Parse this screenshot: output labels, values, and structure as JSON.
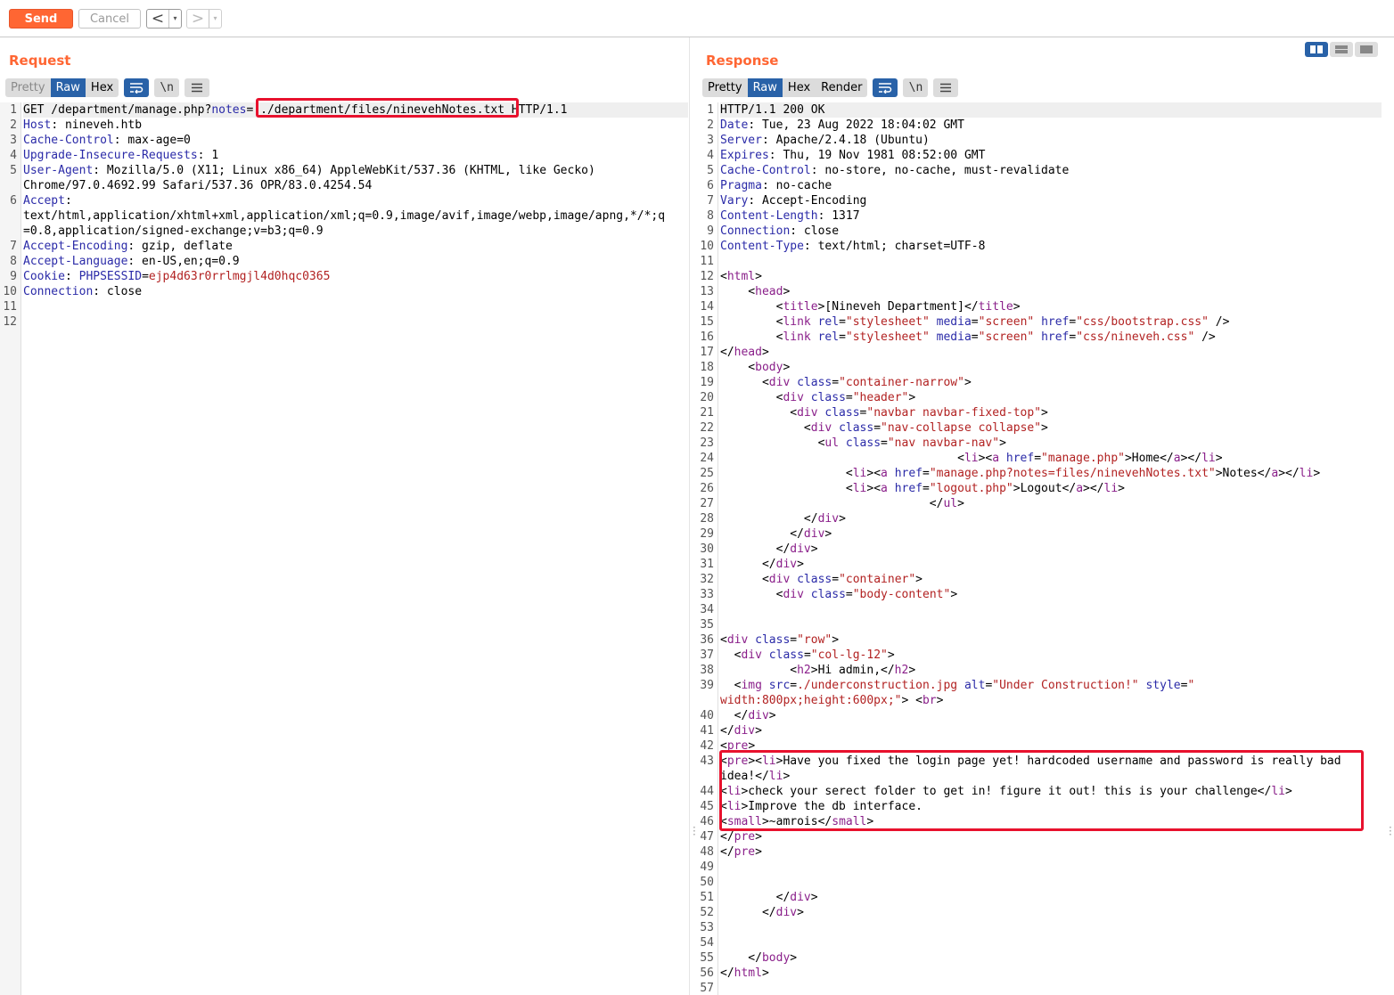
{
  "toolbar": {
    "send_label": "Send",
    "cancel_label": "Cancel",
    "back_label": "<",
    "forward_label": ">",
    "dropdown_glyph": "▾"
  },
  "request": {
    "title": "Request",
    "tabs": [
      "Pretty",
      "Raw",
      "Hex"
    ],
    "active_tab": "Raw",
    "tools": [
      "wrap-icon",
      "\\n",
      "menu-icon"
    ],
    "line_numbers": [
      "1",
      "2",
      "3",
      "4",
      "5",
      "",
      "6",
      "",
      "",
      "7",
      "8",
      "9",
      "10",
      "11",
      "12"
    ],
    "lines": [
      [
        [
          "t",
          "GET /department/manage.php?"
        ],
        [
          "k",
          "notes"
        ],
        [
          "t",
          "=../department/files/ninevehNotes.txt HTTP/1.1"
        ]
      ],
      [
        [
          "k",
          "Host"
        ],
        [
          "t",
          ": nineveh.htb"
        ]
      ],
      [
        [
          "k",
          "Cache-Control"
        ],
        [
          "t",
          ": max-age=0"
        ]
      ],
      [
        [
          "k",
          "Upgrade-Insecure-Requests"
        ],
        [
          "t",
          ": 1"
        ]
      ],
      [
        [
          "k",
          "User-Agent"
        ],
        [
          "t",
          ": Mozilla/5.0 (X11; Linux x86_64) AppleWebKit/537.36 (KHTML, like Gecko)"
        ]
      ],
      [
        [
          "t",
          "Chrome/97.0.4692.99 Safari/537.36 OPR/83.0.4254.54"
        ]
      ],
      [
        [
          "k",
          "Accept"
        ],
        [
          "t",
          ":"
        ]
      ],
      [
        [
          "t",
          "text/html,application/xhtml+xml,application/xml;q=0.9,image/avif,image/webp,image/apng,*/*;q"
        ]
      ],
      [
        [
          "t",
          "=0.8,application/signed-exchange;v=b3;q=0.9"
        ]
      ],
      [
        [
          "k",
          "Accept-Encoding"
        ],
        [
          "t",
          ": gzip, deflate"
        ]
      ],
      [
        [
          "k",
          "Accept-Language"
        ],
        [
          "t",
          ": en-US,en;q=0.9"
        ]
      ],
      [
        [
          "k",
          "Cookie"
        ],
        [
          "t",
          ": "
        ],
        [
          "k",
          "PHPSESSID"
        ],
        [
          "t",
          "="
        ],
        [
          "ck",
          "ejp4d63r0rrlmgjl4d0hqc0365"
        ]
      ],
      [
        [
          "k",
          "Connection"
        ],
        [
          "t",
          ": close"
        ]
      ],
      [
        [
          "t",
          ""
        ]
      ],
      [
        [
          "t",
          ""
        ]
      ]
    ]
  },
  "response": {
    "title": "Response",
    "tabs": [
      "Pretty",
      "Raw",
      "Hex",
      "Render"
    ],
    "active_tab": "Raw",
    "tools": [
      "wrap-icon",
      "\\n",
      "menu-icon"
    ],
    "line_numbers": [
      "1",
      "2",
      "3",
      "4",
      "5",
      "6",
      "7",
      "8",
      "9",
      "10",
      "11",
      "12",
      "13",
      "14",
      "15",
      "16",
      "17",
      "18",
      "19",
      "20",
      "21",
      "22",
      "23",
      "24",
      "25",
      "26",
      "27",
      "28",
      "29",
      "30",
      "31",
      "32",
      "33",
      "34",
      "35",
      "36",
      "37",
      "38",
      "39",
      "",
      "40",
      "41",
      "42",
      "43",
      "",
      "44",
      "45",
      "46",
      "47",
      "48",
      "49",
      "50",
      "51",
      "52",
      "53",
      "54",
      "55",
      "56",
      "57"
    ],
    "lines": [
      [
        [
          "t",
          "HTTP/1.1 200 OK"
        ]
      ],
      [
        [
          "k",
          "Date"
        ],
        [
          "t",
          ": Tue, 23 Aug 2022 18:04:02 GMT"
        ]
      ],
      [
        [
          "k",
          "Server"
        ],
        [
          "t",
          ": Apache/2.4.18 (Ubuntu)"
        ]
      ],
      [
        [
          "k",
          "Expires"
        ],
        [
          "t",
          ": Thu, 19 Nov 1981 08:52:00 GMT"
        ]
      ],
      [
        [
          "k",
          "Cache-Control"
        ],
        [
          "t",
          ": no-store, no-cache, must-revalidate"
        ]
      ],
      [
        [
          "k",
          "Pragma"
        ],
        [
          "t",
          ": no-cache"
        ]
      ],
      [
        [
          "k",
          "Vary"
        ],
        [
          "t",
          ": Accept-Encoding"
        ]
      ],
      [
        [
          "k",
          "Content-Length"
        ],
        [
          "t",
          ": 1317"
        ]
      ],
      [
        [
          "k",
          "Connection"
        ],
        [
          "t",
          ": close"
        ]
      ],
      [
        [
          "k",
          "Content-Type"
        ],
        [
          "t",
          ": text/html; charset=UTF-8"
        ]
      ],
      [
        [
          "t",
          ""
        ]
      ],
      [
        [
          "t",
          "<"
        ],
        [
          "tg",
          "html"
        ],
        [
          "t",
          ">"
        ]
      ],
      [
        [
          "t",
          "    <"
        ],
        [
          "tg",
          "head"
        ],
        [
          "t",
          ">"
        ]
      ],
      [
        [
          "t",
          "        <"
        ],
        [
          "tg",
          "title"
        ],
        [
          "t",
          ">[Nineveh Department]</"
        ],
        [
          "tg",
          "title"
        ],
        [
          "t",
          ">"
        ]
      ],
      [
        [
          "t",
          "        <"
        ],
        [
          "tg",
          "link"
        ],
        [
          "t",
          " "
        ],
        [
          "at",
          "rel"
        ],
        [
          "t",
          "="
        ],
        [
          "st",
          "\"stylesheet\""
        ],
        [
          "t",
          " "
        ],
        [
          "at",
          "media"
        ],
        [
          "t",
          "="
        ],
        [
          "st",
          "\"screen\""
        ],
        [
          "t",
          " "
        ],
        [
          "at",
          "href"
        ],
        [
          "t",
          "="
        ],
        [
          "st",
          "\"css/bootstrap.css\""
        ],
        [
          "t",
          " />"
        ]
      ],
      [
        [
          "t",
          "        <"
        ],
        [
          "tg",
          "link"
        ],
        [
          "t",
          " "
        ],
        [
          "at",
          "rel"
        ],
        [
          "t",
          "="
        ],
        [
          "st",
          "\"stylesheet\""
        ],
        [
          "t",
          " "
        ],
        [
          "at",
          "media"
        ],
        [
          "t",
          "="
        ],
        [
          "st",
          "\"screen\""
        ],
        [
          "t",
          " "
        ],
        [
          "at",
          "href"
        ],
        [
          "t",
          "="
        ],
        [
          "st",
          "\"css/nineveh.css\""
        ],
        [
          "t",
          " />"
        ]
      ],
      [
        [
          "t",
          "</"
        ],
        [
          "tg",
          "head"
        ],
        [
          "t",
          ">"
        ]
      ],
      [
        [
          "t",
          "    <"
        ],
        [
          "tg",
          "body"
        ],
        [
          "t",
          ">"
        ]
      ],
      [
        [
          "t",
          "      <"
        ],
        [
          "tg",
          "div"
        ],
        [
          "t",
          " "
        ],
        [
          "at",
          "class"
        ],
        [
          "t",
          "="
        ],
        [
          "st",
          "\"container-narrow\""
        ],
        [
          "t",
          ">"
        ]
      ],
      [
        [
          "t",
          "        <"
        ],
        [
          "tg",
          "div"
        ],
        [
          "t",
          " "
        ],
        [
          "at",
          "class"
        ],
        [
          "t",
          "="
        ],
        [
          "st",
          "\"header\""
        ],
        [
          "t",
          ">"
        ]
      ],
      [
        [
          "t",
          "          <"
        ],
        [
          "tg",
          "div"
        ],
        [
          "t",
          " "
        ],
        [
          "at",
          "class"
        ],
        [
          "t",
          "="
        ],
        [
          "st",
          "\"navbar navbar-fixed-top\""
        ],
        [
          "t",
          ">"
        ]
      ],
      [
        [
          "t",
          "            <"
        ],
        [
          "tg",
          "div"
        ],
        [
          "t",
          " "
        ],
        [
          "at",
          "class"
        ],
        [
          "t",
          "="
        ],
        [
          "st",
          "\"nav-collapse collapse\""
        ],
        [
          "t",
          ">"
        ]
      ],
      [
        [
          "t",
          "              <"
        ],
        [
          "tg",
          "ul"
        ],
        [
          "t",
          " "
        ],
        [
          "at",
          "class"
        ],
        [
          "t",
          "="
        ],
        [
          "st",
          "\"nav navbar-nav\""
        ],
        [
          "t",
          ">"
        ]
      ],
      [
        [
          "t",
          "                                  <"
        ],
        [
          "tg",
          "li"
        ],
        [
          "t",
          "><"
        ],
        [
          "tg",
          "a"
        ],
        [
          "t",
          " "
        ],
        [
          "at",
          "href"
        ],
        [
          "t",
          "="
        ],
        [
          "st",
          "\"manage.php\""
        ],
        [
          "t",
          ">Home</"
        ],
        [
          "tg",
          "a"
        ],
        [
          "t",
          "></"
        ],
        [
          "tg",
          "li"
        ],
        [
          "t",
          ">"
        ]
      ],
      [
        [
          "t",
          "                  <"
        ],
        [
          "tg",
          "li"
        ],
        [
          "t",
          "><"
        ],
        [
          "tg",
          "a"
        ],
        [
          "t",
          " "
        ],
        [
          "at",
          "href"
        ],
        [
          "t",
          "="
        ],
        [
          "st",
          "\"manage.php?notes=files/ninevehNotes.txt\""
        ],
        [
          "t",
          ">Notes</"
        ],
        [
          "tg",
          "a"
        ],
        [
          "t",
          "></"
        ],
        [
          "tg",
          "li"
        ],
        [
          "t",
          ">"
        ]
      ],
      [
        [
          "t",
          "                  <"
        ],
        [
          "tg",
          "li"
        ],
        [
          "t",
          "><"
        ],
        [
          "tg",
          "a"
        ],
        [
          "t",
          " "
        ],
        [
          "at",
          "href"
        ],
        [
          "t",
          "="
        ],
        [
          "st",
          "\"logout.php\""
        ],
        [
          "t",
          ">Logout</"
        ],
        [
          "tg",
          "a"
        ],
        [
          "t",
          "></"
        ],
        [
          "tg",
          "li"
        ],
        [
          "t",
          ">"
        ]
      ],
      [
        [
          "t",
          "                              </"
        ],
        [
          "tg",
          "ul"
        ],
        [
          "t",
          ">"
        ]
      ],
      [
        [
          "t",
          "            </"
        ],
        [
          "tg",
          "div"
        ],
        [
          "t",
          ">"
        ]
      ],
      [
        [
          "t",
          "          </"
        ],
        [
          "tg",
          "div"
        ],
        [
          "t",
          ">"
        ]
      ],
      [
        [
          "t",
          "        </"
        ],
        [
          "tg",
          "div"
        ],
        [
          "t",
          ">"
        ]
      ],
      [
        [
          "t",
          "      </"
        ],
        [
          "tg",
          "div"
        ],
        [
          "t",
          ">"
        ]
      ],
      [
        [
          "t",
          "      <"
        ],
        [
          "tg",
          "div"
        ],
        [
          "t",
          " "
        ],
        [
          "at",
          "class"
        ],
        [
          "t",
          "="
        ],
        [
          "st",
          "\"container\""
        ],
        [
          "t",
          ">"
        ]
      ],
      [
        [
          "t",
          "        <"
        ],
        [
          "tg",
          "div"
        ],
        [
          "t",
          " "
        ],
        [
          "at",
          "class"
        ],
        [
          "t",
          "="
        ],
        [
          "st",
          "\"body-content\""
        ],
        [
          "t",
          ">"
        ]
      ],
      [
        [
          "t",
          ""
        ]
      ],
      [
        [
          "t",
          ""
        ]
      ],
      [
        [
          "t",
          "<"
        ],
        [
          "tg",
          "div"
        ],
        [
          "t",
          " "
        ],
        [
          "at",
          "class"
        ],
        [
          "t",
          "="
        ],
        [
          "st",
          "\"row\""
        ],
        [
          "t",
          ">"
        ]
      ],
      [
        [
          "t",
          "  <"
        ],
        [
          "tg",
          "div"
        ],
        [
          "t",
          " "
        ],
        [
          "at",
          "class"
        ],
        [
          "t",
          "="
        ],
        [
          "st",
          "\"col-lg-12\""
        ],
        [
          "t",
          ">"
        ]
      ],
      [
        [
          "t",
          "          <"
        ],
        [
          "tg",
          "h2"
        ],
        [
          "t",
          ">Hi admin,</"
        ],
        [
          "tg",
          "h2"
        ],
        [
          "t",
          ">"
        ]
      ],
      [
        [
          "t",
          "  <"
        ],
        [
          "tg",
          "img"
        ],
        [
          "t",
          " "
        ],
        [
          "at",
          "src"
        ],
        [
          "t",
          "="
        ],
        [
          "st",
          "./underconstruction.jpg"
        ],
        [
          "t",
          " "
        ],
        [
          "at",
          "alt"
        ],
        [
          "t",
          "="
        ],
        [
          "st",
          "\"Under Construction!\""
        ],
        [
          "t",
          " "
        ],
        [
          "at",
          "style"
        ],
        [
          "t",
          "="
        ],
        [
          "st",
          "\""
        ]
      ],
      [
        [
          "st",
          "width:800px;height:600px;\""
        ],
        [
          "t",
          "> <"
        ],
        [
          "tg",
          "br"
        ],
        [
          "t",
          ">"
        ]
      ],
      [
        [
          "t",
          "  </"
        ],
        [
          "tg",
          "div"
        ],
        [
          "t",
          ">"
        ]
      ],
      [
        [
          "t",
          "</"
        ],
        [
          "tg",
          "div"
        ],
        [
          "t",
          ">"
        ]
      ],
      [
        [
          "t",
          "<"
        ],
        [
          "tg",
          "pre"
        ],
        [
          "t",
          ">"
        ]
      ],
      [
        [
          "t",
          "<"
        ],
        [
          "tg",
          "pre"
        ],
        [
          "t",
          "><"
        ],
        [
          "tg",
          "li"
        ],
        [
          "t",
          ">Have you fixed the login page yet! hardcoded username and password is really bad"
        ]
      ],
      [
        [
          "t",
          "idea!</"
        ],
        [
          "tg",
          "li"
        ],
        [
          "t",
          ">"
        ]
      ],
      [
        [
          "t",
          "<"
        ],
        [
          "tg",
          "li"
        ],
        [
          "t",
          ">check your serect folder to get in! figure it out! this is your challenge</"
        ],
        [
          "tg",
          "li"
        ],
        [
          "t",
          ">"
        ]
      ],
      [
        [
          "t",
          "<"
        ],
        [
          "tg",
          "li"
        ],
        [
          "t",
          ">Improve the db interface."
        ]
      ],
      [
        [
          "t",
          "<"
        ],
        [
          "tg",
          "small"
        ],
        [
          "t",
          ">~amrois</"
        ],
        [
          "tg",
          "small"
        ],
        [
          "t",
          ">"
        ]
      ],
      [
        [
          "t",
          "</"
        ],
        [
          "tg",
          "pre"
        ],
        [
          "t",
          ">"
        ]
      ],
      [
        [
          "t",
          "</"
        ],
        [
          "tg",
          "pre"
        ],
        [
          "t",
          ">"
        ]
      ],
      [
        [
          "t",
          ""
        ]
      ],
      [
        [
          "t",
          ""
        ]
      ],
      [
        [
          "t",
          "        </"
        ],
        [
          "tg",
          "div"
        ],
        [
          "t",
          ">"
        ]
      ],
      [
        [
          "t",
          "      </"
        ],
        [
          "tg",
          "div"
        ],
        [
          "t",
          ">"
        ]
      ],
      [
        [
          "t",
          ""
        ]
      ],
      [
        [
          "t",
          ""
        ]
      ],
      [
        [
          "t",
          "    </"
        ],
        [
          "tg",
          "body"
        ],
        [
          "t",
          ">"
        ]
      ],
      [
        [
          "t",
          "</"
        ],
        [
          "tg",
          "html"
        ],
        [
          "t",
          ">"
        ]
      ],
      [
        [
          "t",
          ""
        ]
      ]
    ]
  },
  "layout_options": [
    "side-by-side",
    "top-bottom",
    "tabs"
  ],
  "colors": {
    "accent": "#ff6633",
    "active_tab": "#2962a8",
    "highlight_box": "#e8112d"
  }
}
